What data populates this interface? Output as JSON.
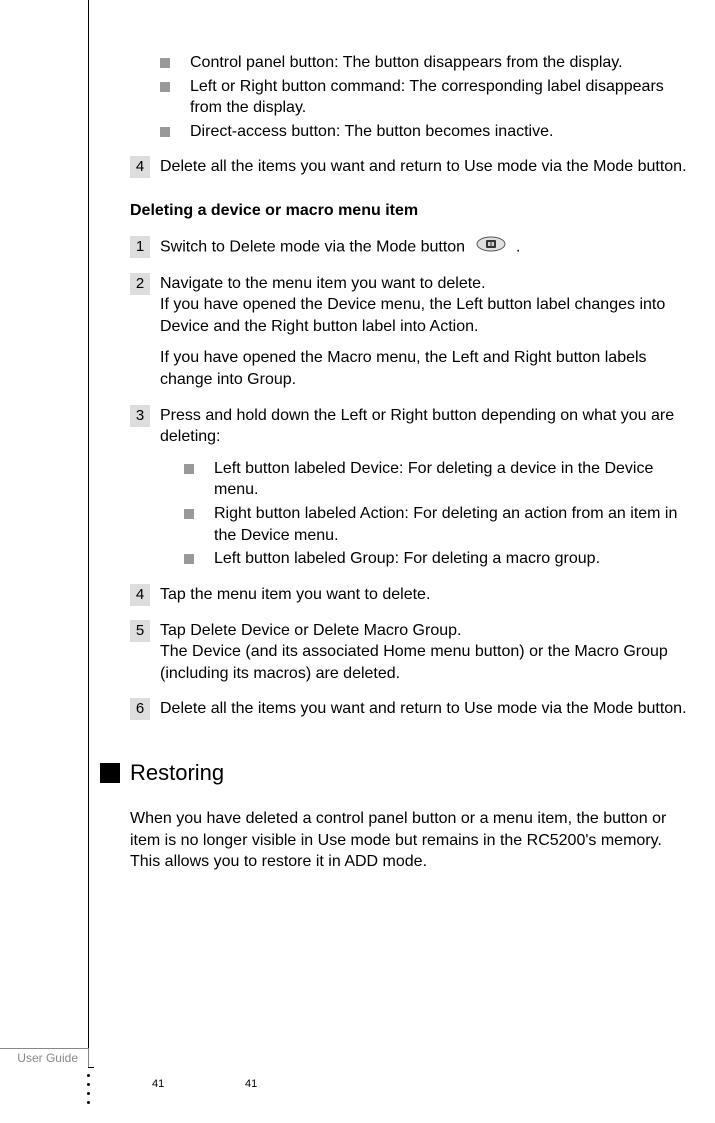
{
  "bullets_top": [
    "Control panel button: The button disappears from the display.",
    "Left or Right button command: The corresponding label disappears from the display.",
    "Direct-access button: The button becomes inactive."
  ],
  "step4a": {
    "num": "4",
    "text": "Delete all the items you want and return to Use mode via the Mode button."
  },
  "subhead1": "Deleting a device or macro menu item",
  "d_step1": {
    "num": "1",
    "text_before": "Switch to Delete mode via the Mode button ",
    "text_after": " ."
  },
  "d_step2": {
    "num": "2",
    "p1": "Navigate to the menu item you want to delete.",
    "p2": "If you have opened the Device menu, the Left button label changes into Device and the Right button label into Action.",
    "p3": "If you have opened the Macro menu, the Left and Right button labels change into Group."
  },
  "d_step3": {
    "num": "3",
    "text": "Press and hold down the Left or Right button depending on what you are deleting:",
    "bullets": [
      "Left button labeled Device: For deleting a device in the Device menu.",
      "Right button labeled Action: For deleting an action from an item in the Device menu.",
      "Left button labeled Group: For deleting a macro group."
    ]
  },
  "d_step4": {
    "num": "4",
    "text": "Tap the menu item you want to delete."
  },
  "d_step5": {
    "num": "5",
    "p1": "Tap Delete Device or Delete Macro Group.",
    "p2": "The Device (and its associated Home menu button) or the Macro Group (including its macros) are deleted."
  },
  "d_step6": {
    "num": "6",
    "text": "Delete all the items you want and return to Use mode via the Mode button."
  },
  "section_head": "Restoring",
  "restoring_para": "When you have deleted a control panel button or a menu item, the button or item is no longer visible in Use mode but remains in the RC5200's memory. This allows you to restore it in ADD mode.",
  "footer_label": "User Guide",
  "page_left": "41",
  "page_right": "41"
}
